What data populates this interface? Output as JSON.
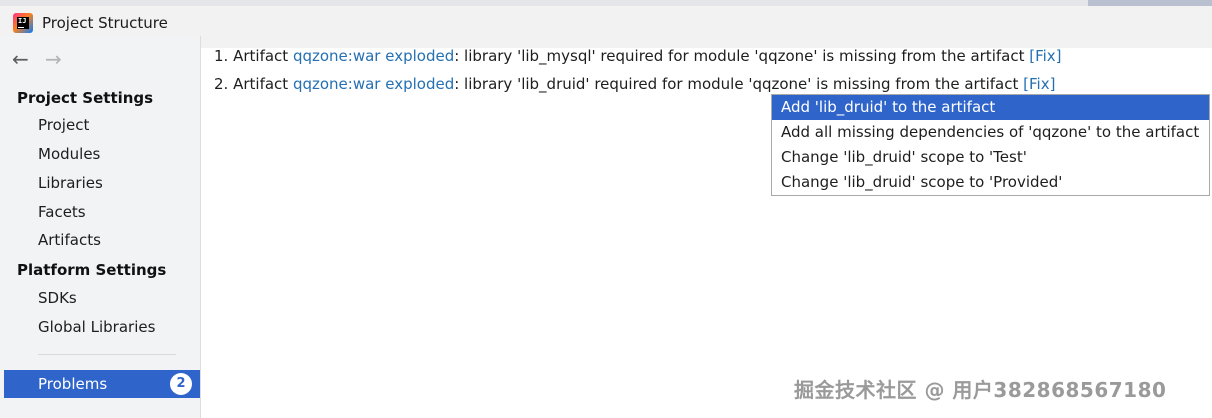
{
  "window": {
    "title": "Project Structure"
  },
  "sidebar": {
    "project_settings_header": "Project Settings",
    "project_items": [
      {
        "label": "Project"
      },
      {
        "label": "Modules"
      },
      {
        "label": "Libraries"
      },
      {
        "label": "Facets"
      },
      {
        "label": "Artifacts"
      }
    ],
    "platform_settings_header": "Platform Settings",
    "platform_items": [
      {
        "label": "SDKs"
      },
      {
        "label": "Global Libraries"
      }
    ],
    "problems": {
      "label": "Problems",
      "count": "2"
    }
  },
  "problems": [
    {
      "index": "1.",
      "prefix": "Artifact",
      "artifact": "qqzone:war exploded",
      "message": ": library 'lib_mysql' required for module 'qqzone' is missing from the artifact",
      "fix": "[Fix]"
    },
    {
      "index": "2.",
      "prefix": "Artifact",
      "artifact": "qqzone:war exploded",
      "message": ": library 'lib_druid' required for module 'qqzone' is missing from the artifact",
      "fix": "[Fix]"
    }
  ],
  "fix_menu": {
    "items": [
      {
        "label": "Add 'lib_druid' to the artifact",
        "selected": true
      },
      {
        "label": "Add all missing dependencies of 'qqzone' to the artifact",
        "selected": false
      },
      {
        "label": "Change 'lib_druid' scope to 'Test'",
        "selected": false
      },
      {
        "label": "Change 'lib_druid' scope to 'Provided'",
        "selected": false
      }
    ]
  },
  "watermark": "掘金技术社区 @ 用户382868567180",
  "colors": {
    "selection": "#2f65ca",
    "link": "#2470b3"
  }
}
